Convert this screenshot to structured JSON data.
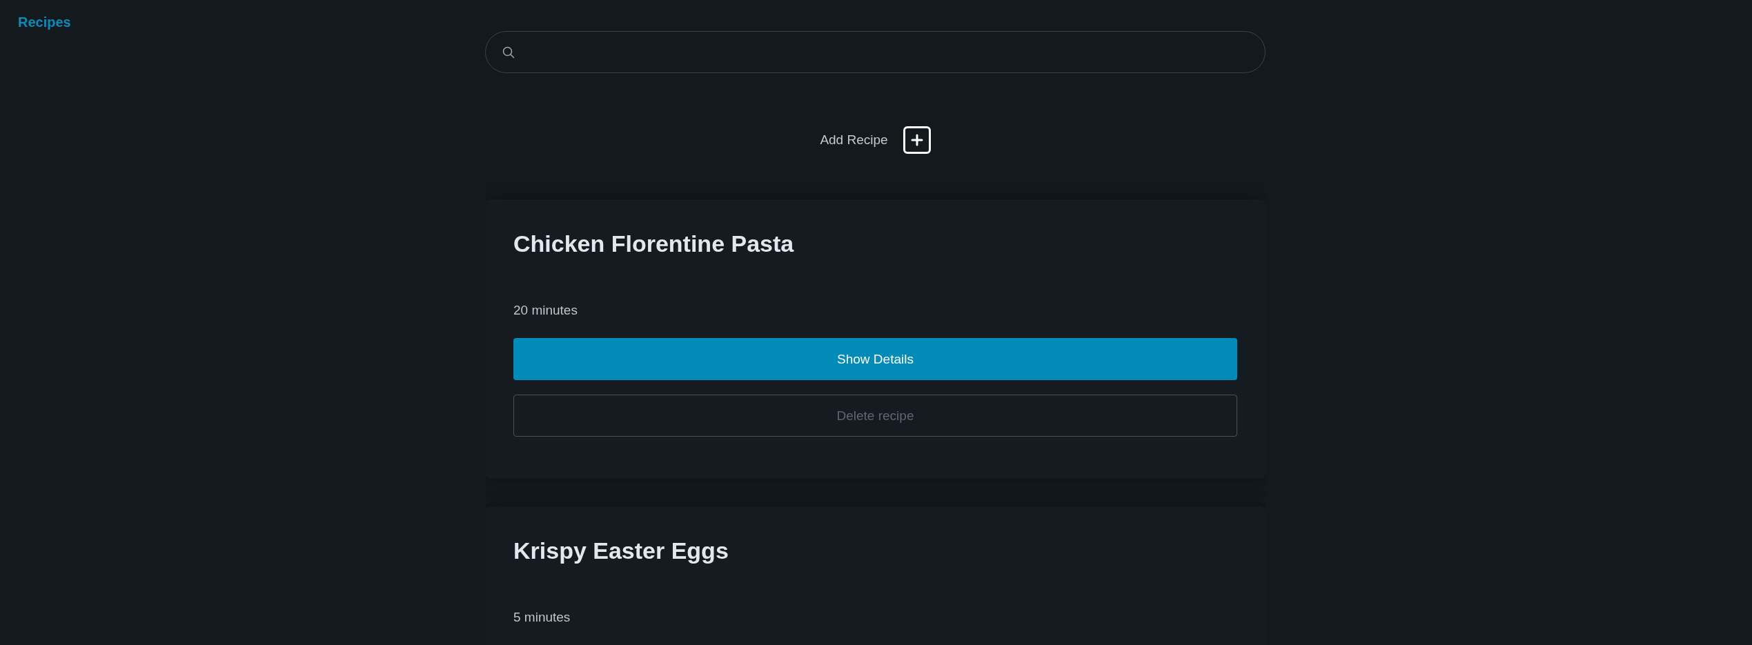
{
  "brand": "Recipes",
  "add_recipe": {
    "label": "Add Recipe"
  },
  "recipes": [
    {
      "title": "Chicken Florentine Pasta",
      "time": "20 minutes",
      "buttons": [
        {
          "label": "Show Details",
          "kind": "primary",
          "disabled": false
        },
        {
          "label": "Delete recipe",
          "kind": "outline",
          "disabled": true
        }
      ]
    },
    {
      "title": "Krispy Easter Eggs",
      "time": "5 minutes"
    }
  ]
}
